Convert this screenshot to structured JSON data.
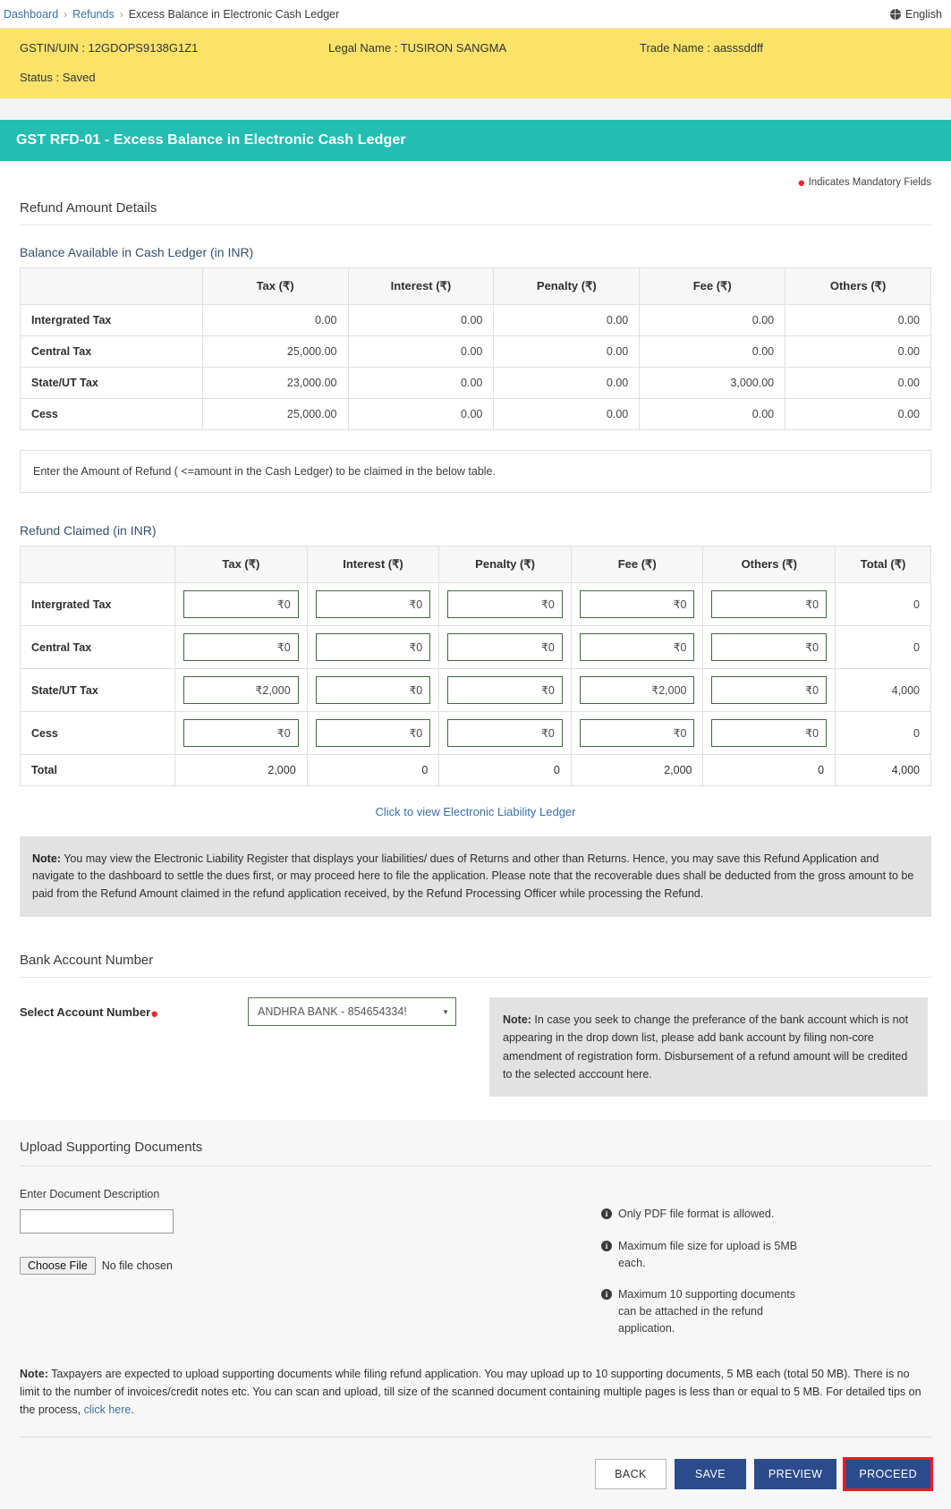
{
  "breadcrumb": {
    "items": [
      "Dashboard",
      "Refunds",
      "Excess Balance in Electronic Cash Ledger"
    ],
    "sep": "›"
  },
  "topbar": {
    "language": "English",
    "globe_icon": "globe-icon"
  },
  "taxpayer": {
    "gstin": "GSTIN/UIN : 12GDOPS9138G1Z1",
    "legal_name": "Legal Name : TUSIRON SANGMA",
    "trade_name": "Trade Name : aasssddff",
    "status": "Status : Saved"
  },
  "form": {
    "header": "GST RFD-01 - Excess Balance in Electronic Cash Ledger",
    "mandatory_note": "Indicates Mandatory Fields",
    "section_title": "Refund Amount Details"
  },
  "balance_table": {
    "title": "Balance Available in Cash Ledger (in INR)",
    "columns": [
      "",
      "Tax (₹)",
      "Interest (₹)",
      "Penalty (₹)",
      "Fee (₹)",
      "Others (₹)"
    ],
    "rows": [
      {
        "label": "Intergrated Tax",
        "tax": "0.00",
        "interest": "0.00",
        "penalty": "0.00",
        "fee": "0.00",
        "others": "0.00"
      },
      {
        "label": "Central Tax",
        "tax": "25,000.00",
        "interest": "0.00",
        "penalty": "0.00",
        "fee": "0.00",
        "others": "0.00"
      },
      {
        "label": "State/UT Tax",
        "tax": "23,000.00",
        "interest": "0.00",
        "penalty": "0.00",
        "fee": "3,000.00",
        "others": "0.00"
      },
      {
        "label": "Cess",
        "tax": "25,000.00",
        "interest": "0.00",
        "penalty": "0.00",
        "fee": "0.00",
        "others": "0.00"
      }
    ]
  },
  "hint": "Enter the Amount of Refund ( <=amount in the Cash Ledger) to be claimed in the below table.",
  "claim_table": {
    "title": "Refund Claimed (in INR)",
    "columns": [
      "",
      "Tax (₹)",
      "Interest (₹)",
      "Penalty (₹)",
      "Fee (₹)",
      "Others (₹)",
      "Total (₹)"
    ],
    "rows": [
      {
        "label": "Intergrated Tax",
        "tax": "₹0",
        "interest": "₹0",
        "penalty": "₹0",
        "fee": "₹0",
        "others": "₹0",
        "total": "0"
      },
      {
        "label": "Central Tax",
        "tax": "₹0",
        "interest": "₹0",
        "penalty": "₹0",
        "fee": "₹0",
        "others": "₹0",
        "total": "0"
      },
      {
        "label": "State/UT Tax",
        "tax": "₹2,000",
        "interest": "₹0",
        "penalty": "₹0",
        "fee": "₹2,000",
        "others": "₹0",
        "total": "4,000"
      },
      {
        "label": "Cess",
        "tax": "₹0",
        "interest": "₹0",
        "penalty": "₹0",
        "fee": "₹0",
        "others": "₹0",
        "total": "0"
      }
    ],
    "total_row": {
      "label": "Total",
      "tax": "2,000",
      "interest": "0",
      "penalty": "0",
      "fee": "2,000",
      "others": "0",
      "total": "4,000"
    }
  },
  "ledger_link": "Click to view Electronic Liability Ledger",
  "liability_note": {
    "prefix": "Note:",
    "text": " You may view the Electronic Liability Register that displays your liabilities/ dues of Returns and other than Returns. Hence, you may save this Refund Application and navigate to the dashboard to settle the dues first, or may proceed here to file the application. Please note that the recoverable dues shall be deducted from the gross amount to be paid from the Refund Amount claimed in the refund application received, by the Refund Processing Officer while processing the Refund."
  },
  "bank": {
    "title": "Bank Account Number",
    "label": "Select Account Number",
    "selected": "ANDHRA BANK - 854654334!",
    "caret_icon": "chevron-down-icon",
    "note_prefix": "Note:",
    "note_text": " In case you seek to change the preferance of the bank account which is not appearing in the drop down list, please add bank account by filing non-core amendment of registration form. Disbursement of a refund amount will be credited to the selected acccount here."
  },
  "upload": {
    "title": "Upload Supporting Documents",
    "desc_label": "Enter Document Description",
    "desc_value": "",
    "desc_placeholder": "",
    "choose_file_label": "Choose File",
    "file_status": "No file chosen",
    "info_items": [
      "Only PDF file format is allowed.",
      "Maximum file size for upload is 5MB each.",
      "Maximum 10 supporting documents can be attached in the refund application."
    ],
    "footnote_prefix": "Note:",
    "footnote_text": " Taxpayers are expected to upload supporting documents while filing refund application. You may upload up to 10 supporting documents, 5 MB each (total 50 MB). There is no limit to the number of invoices/credit notes etc. You can scan and upload, till size of the scanned document containing multiple pages is less than or equal to 5 MB. For detailed tips on the process, ",
    "footnote_link": "click here",
    "footnote_suffix": "."
  },
  "actions": {
    "back": "BACK",
    "save": "SAVE",
    "preview": "PREVIEW",
    "proceed": "PROCEED"
  },
  "colors": {
    "banner_yellow": "#fbe36a",
    "header_teal": "#23bdb1",
    "button_navy": "#2b4b8c",
    "highlight_red": "#ed1c24",
    "link_blue": "#3b6fa8",
    "input_green": "#3d6b3d"
  }
}
